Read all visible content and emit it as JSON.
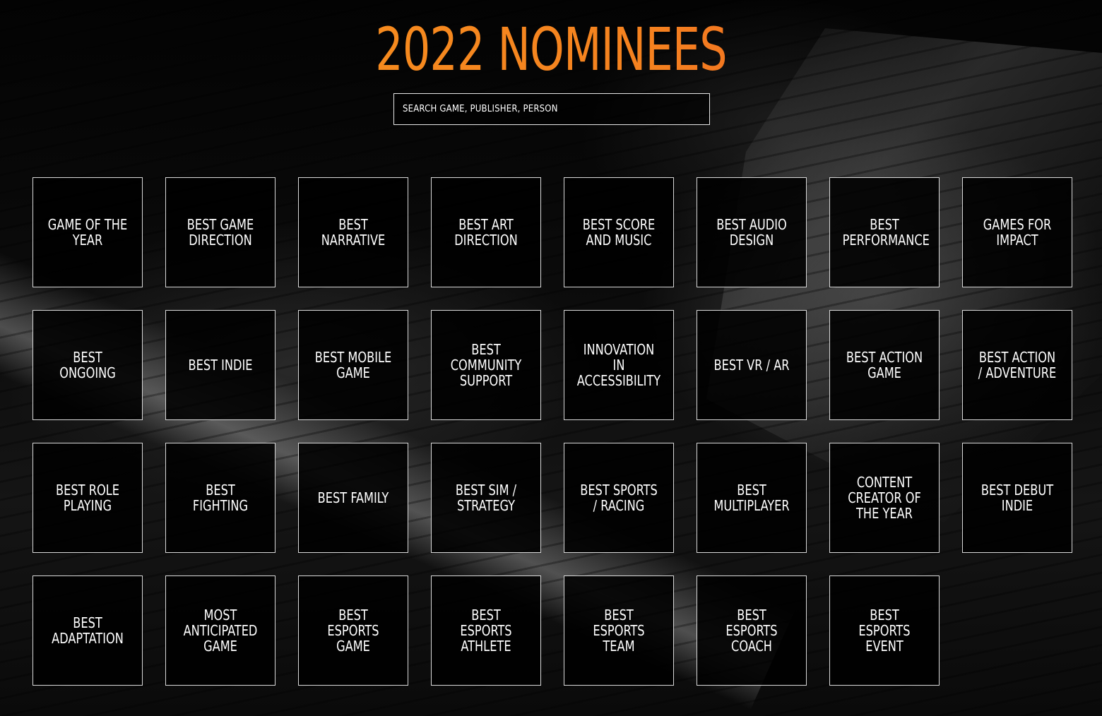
{
  "page": {
    "title": "2022 NOMINEES"
  },
  "search": {
    "placeholder": "SEARCH GAME, PUBLISHER, PERSON"
  },
  "categories": [
    "GAME OF THE YEAR",
    "BEST GAME DIRECTION",
    "BEST NARRATIVE",
    "BEST ART DIRECTION",
    "BEST SCORE AND MUSIC",
    "BEST AUDIO DESIGN",
    "BEST PERFORMANCE",
    "GAMES FOR IMPACT",
    "BEST ONGOING",
    "BEST INDIE",
    "BEST MOBILE GAME",
    "BEST COMMUNITY SUPPORT",
    "INNOVATION IN ACCESSIBILITY",
    "BEST VR / AR",
    "BEST ACTION GAME",
    "BEST ACTION / ADVENTURE",
    "BEST ROLE PLAYING",
    "BEST FIGHTING",
    "BEST FAMILY",
    "BEST SIM / STRATEGY",
    "BEST SPORTS / RACING",
    "BEST MULTIPLAYER",
    "CONTENT CREATOR OF THE YEAR",
    "BEST DEBUT INDIE",
    "BEST ADAPTATION",
    "MOST ANTICIPATED GAME",
    "BEST ESPORTS GAME",
    "BEST ESPORTS ATHLETE",
    "BEST ESPORTS TEAM",
    "BEST ESPORTS COACH",
    "BEST ESPORTS EVENT"
  ],
  "colors": {
    "title_gradient_start": "#f7931e",
    "title_gradient_end": "#ee5a24",
    "tile_border": "#d9d9d9",
    "background": "#000000"
  }
}
